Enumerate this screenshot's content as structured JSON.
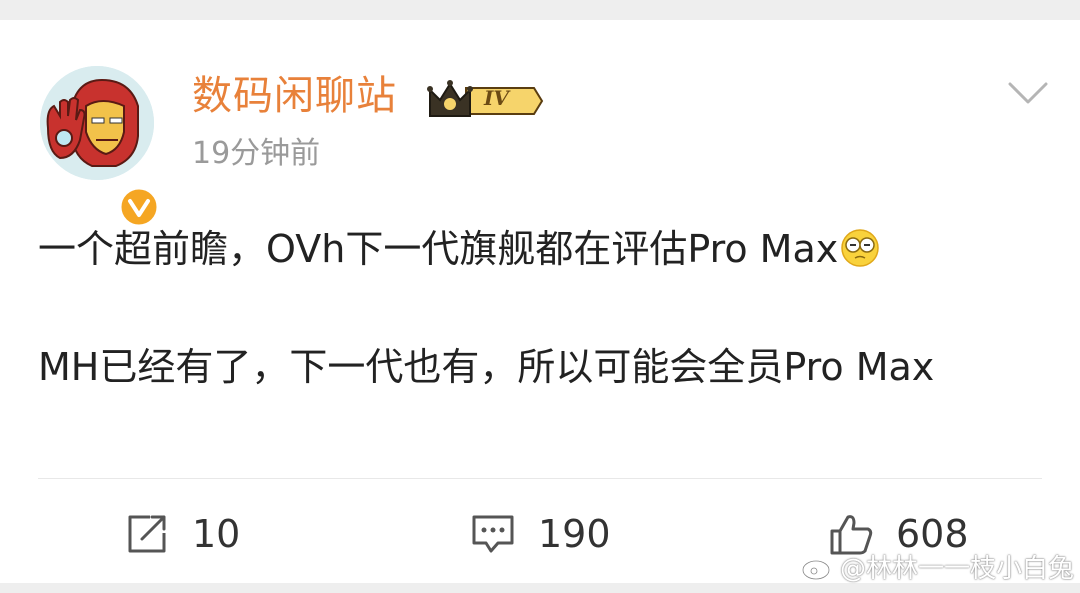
{
  "post": {
    "username": "数码闲聊站",
    "level_badge": "IV",
    "timestamp": "19分钟前",
    "text_line1": "一个超前瞻，OVh下一代旗舰都在评估Pro Max",
    "text_line2": "MH已经有了，下一代也有，所以可能会全员Pro Max"
  },
  "actions": {
    "repost_count": "10",
    "comment_count": "190",
    "like_count": "608"
  },
  "watermark": {
    "text": "@林林一一枝小白兔"
  },
  "colors": {
    "username": "#e8813a",
    "verified": "#f5a623",
    "text": "#222222",
    "muted": "#9a9a9a"
  },
  "icons": {
    "avatar": "iron-man-avatar",
    "verified": "verified-v-icon",
    "badge": "crown-level-badge",
    "menu": "chevron-down-icon",
    "emoji": "squint-emoji",
    "repost": "repost-icon",
    "comment": "comment-icon",
    "like": "thumbs-up-icon",
    "watermark": "weibo-logo-icon"
  }
}
